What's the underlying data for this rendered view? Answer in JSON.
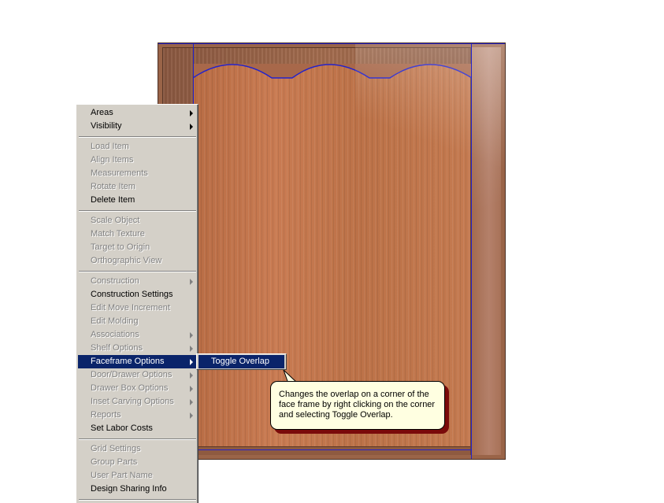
{
  "context_menu": {
    "items": [
      {
        "label": "Areas",
        "enabled": true,
        "submenu": true
      },
      {
        "label": "Visibility",
        "enabled": true,
        "submenu": true
      },
      {
        "label": "Load Item",
        "enabled": false,
        "submenu": false
      },
      {
        "label": "Align Items",
        "enabled": false,
        "submenu": false
      },
      {
        "label": "Measurements",
        "enabled": false,
        "submenu": false
      },
      {
        "label": "Rotate Item",
        "enabled": false,
        "submenu": false
      },
      {
        "label": "Delete Item",
        "enabled": true,
        "submenu": false
      },
      {
        "label": "Scale Object",
        "enabled": false,
        "submenu": false
      },
      {
        "label": "Match Texture",
        "enabled": false,
        "submenu": false
      },
      {
        "label": "Target to Origin",
        "enabled": false,
        "submenu": false
      },
      {
        "label": "Orthographic View",
        "enabled": false,
        "submenu": false
      },
      {
        "label": "Construction",
        "enabled": false,
        "submenu": true
      },
      {
        "label": "Construction Settings",
        "enabled": true,
        "submenu": false
      },
      {
        "label": "Edit Move Increment",
        "enabled": false,
        "submenu": false
      },
      {
        "label": "Edit Molding",
        "enabled": false,
        "submenu": false
      },
      {
        "label": "Associations",
        "enabled": false,
        "submenu": true
      },
      {
        "label": "Shelf Options",
        "enabled": false,
        "submenu": true
      },
      {
        "label": "Faceframe Options",
        "enabled": true,
        "submenu": true,
        "selected": true
      },
      {
        "label": "Door/Drawer Options",
        "enabled": false,
        "submenu": true
      },
      {
        "label": "Drawer Box Options",
        "enabled": false,
        "submenu": true
      },
      {
        "label": "Inset Carving Options",
        "enabled": false,
        "submenu": true
      },
      {
        "label": "Reports",
        "enabled": false,
        "submenu": true
      },
      {
        "label": "Set Labor Costs",
        "enabled": true,
        "submenu": false
      },
      {
        "label": "Grid Settings",
        "enabled": false,
        "submenu": false
      },
      {
        "label": "Group Parts",
        "enabled": false,
        "submenu": false
      },
      {
        "label": "User Part Name",
        "enabled": false,
        "submenu": false
      },
      {
        "label": "Design Sharing Info",
        "enabled": true,
        "submenu": false
      }
    ]
  },
  "submenu": {
    "items": [
      {
        "label": "Toggle Overlap",
        "selected": true
      }
    ]
  },
  "tooltip": {
    "text": "Changes the overlap on a corner of the face frame by right clicking on the corner and selecting Toggle Overlap."
  },
  "colors": {
    "menu_bg": "#d4d0c8",
    "highlight": "#0a246a",
    "disabled_text": "#808080",
    "tooltip_bg": "#ffffe1",
    "tooltip_shadow": "#7a0a0a",
    "guide_line": "#2222cc"
  }
}
